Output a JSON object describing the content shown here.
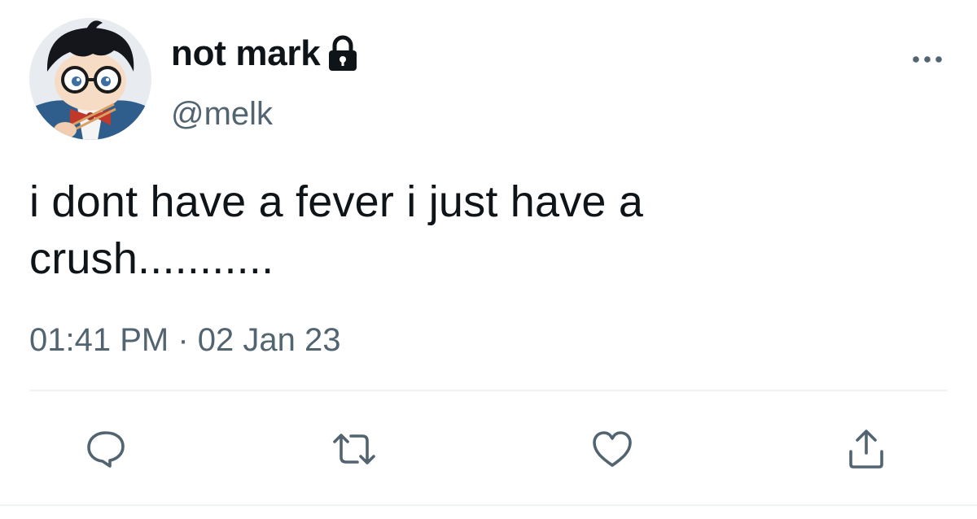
{
  "user": {
    "display_name": "not mark",
    "handle": "@melk",
    "protected": true,
    "avatar": "anime-character-with-glasses"
  },
  "tweet": {
    "text_line1": "i dont have a fever i just have a",
    "text_line2": "crush...........",
    "time": "01:41 PM",
    "separator": "·",
    "date": "02 Jan 23"
  },
  "actions": {
    "reply_icon": "speech-bubble-icon",
    "retweet_icon": "retweet-arrows-icon",
    "like_icon": "heart-icon",
    "share_icon": "share-upload-icon",
    "more_icon": "ellipsis-icon"
  },
  "colors": {
    "text": "#0f1419",
    "secondary": "#536471",
    "icon": "#536471",
    "divider": "#eff3f4"
  }
}
